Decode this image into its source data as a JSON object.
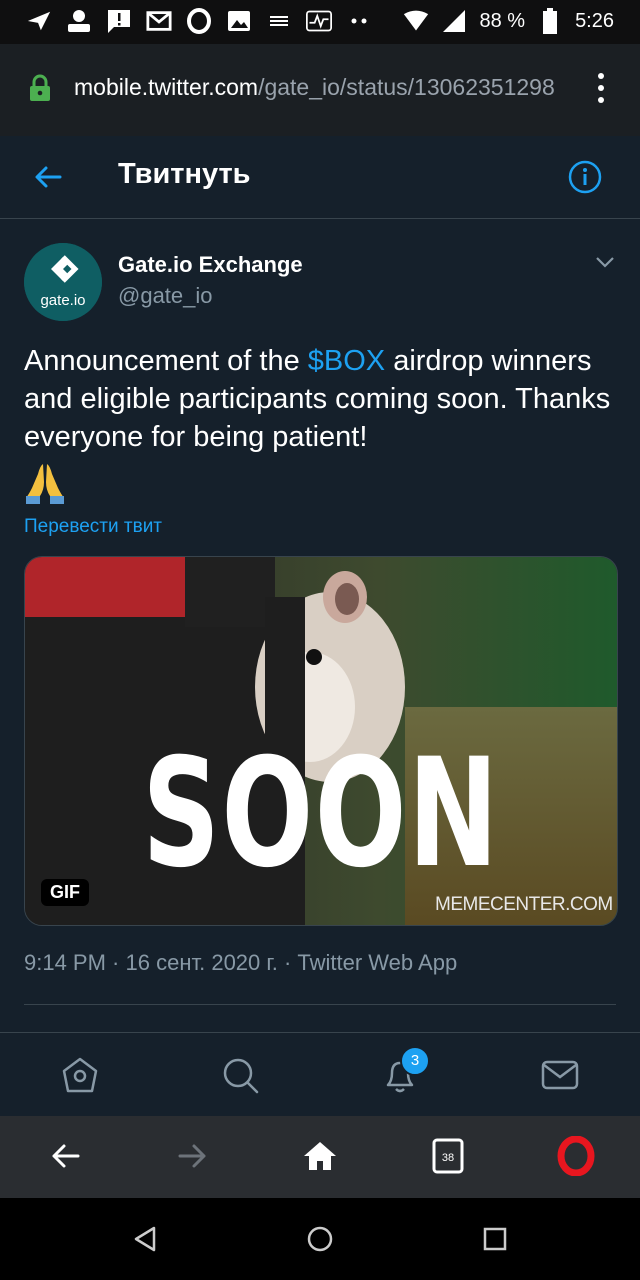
{
  "status_bar": {
    "battery": "88 %",
    "time": "5:26",
    "icons": [
      "send-icon",
      "account-icon",
      "message-alert-icon",
      "gmail-icon",
      "opera-icon",
      "image-icon",
      "wave-icon",
      "pulse-icon",
      "dots-icon",
      "wifi-icon",
      "signal-icon",
      "battery-icon"
    ]
  },
  "browser": {
    "url_host": "mobile.twitter.com",
    "url_path": "/gate_io/status/13062351298"
  },
  "header": {
    "title": "Твитнуть"
  },
  "tweet": {
    "author_name": "Gate.io Exchange",
    "author_handle": "@gate_io",
    "avatar_text": "gate.io",
    "text_before": "Announcement of the ",
    "cashtag": "$BOX",
    "text_after": " airdrop winners and eligible participants coming soon. Thanks everyone for being patient!",
    "emoji": "folded-hands",
    "translate_label": "Перевести твит",
    "media": {
      "overlay_text": "SOON",
      "badge": "GIF",
      "watermark": "MEMECENTER.COM"
    },
    "time": "9:14 PM",
    "date": "16 сент. 2020 г.",
    "source": "Twitter Web App",
    "sep": " · "
  },
  "tabbar": {
    "notifications_badge": "3"
  },
  "browser_nav": {
    "tabs_count": "38"
  },
  "colors": {
    "background": "#15202b",
    "accent": "#1da1f2",
    "secondary_text": "#8899a6",
    "opera_red": "#e8161f"
  }
}
